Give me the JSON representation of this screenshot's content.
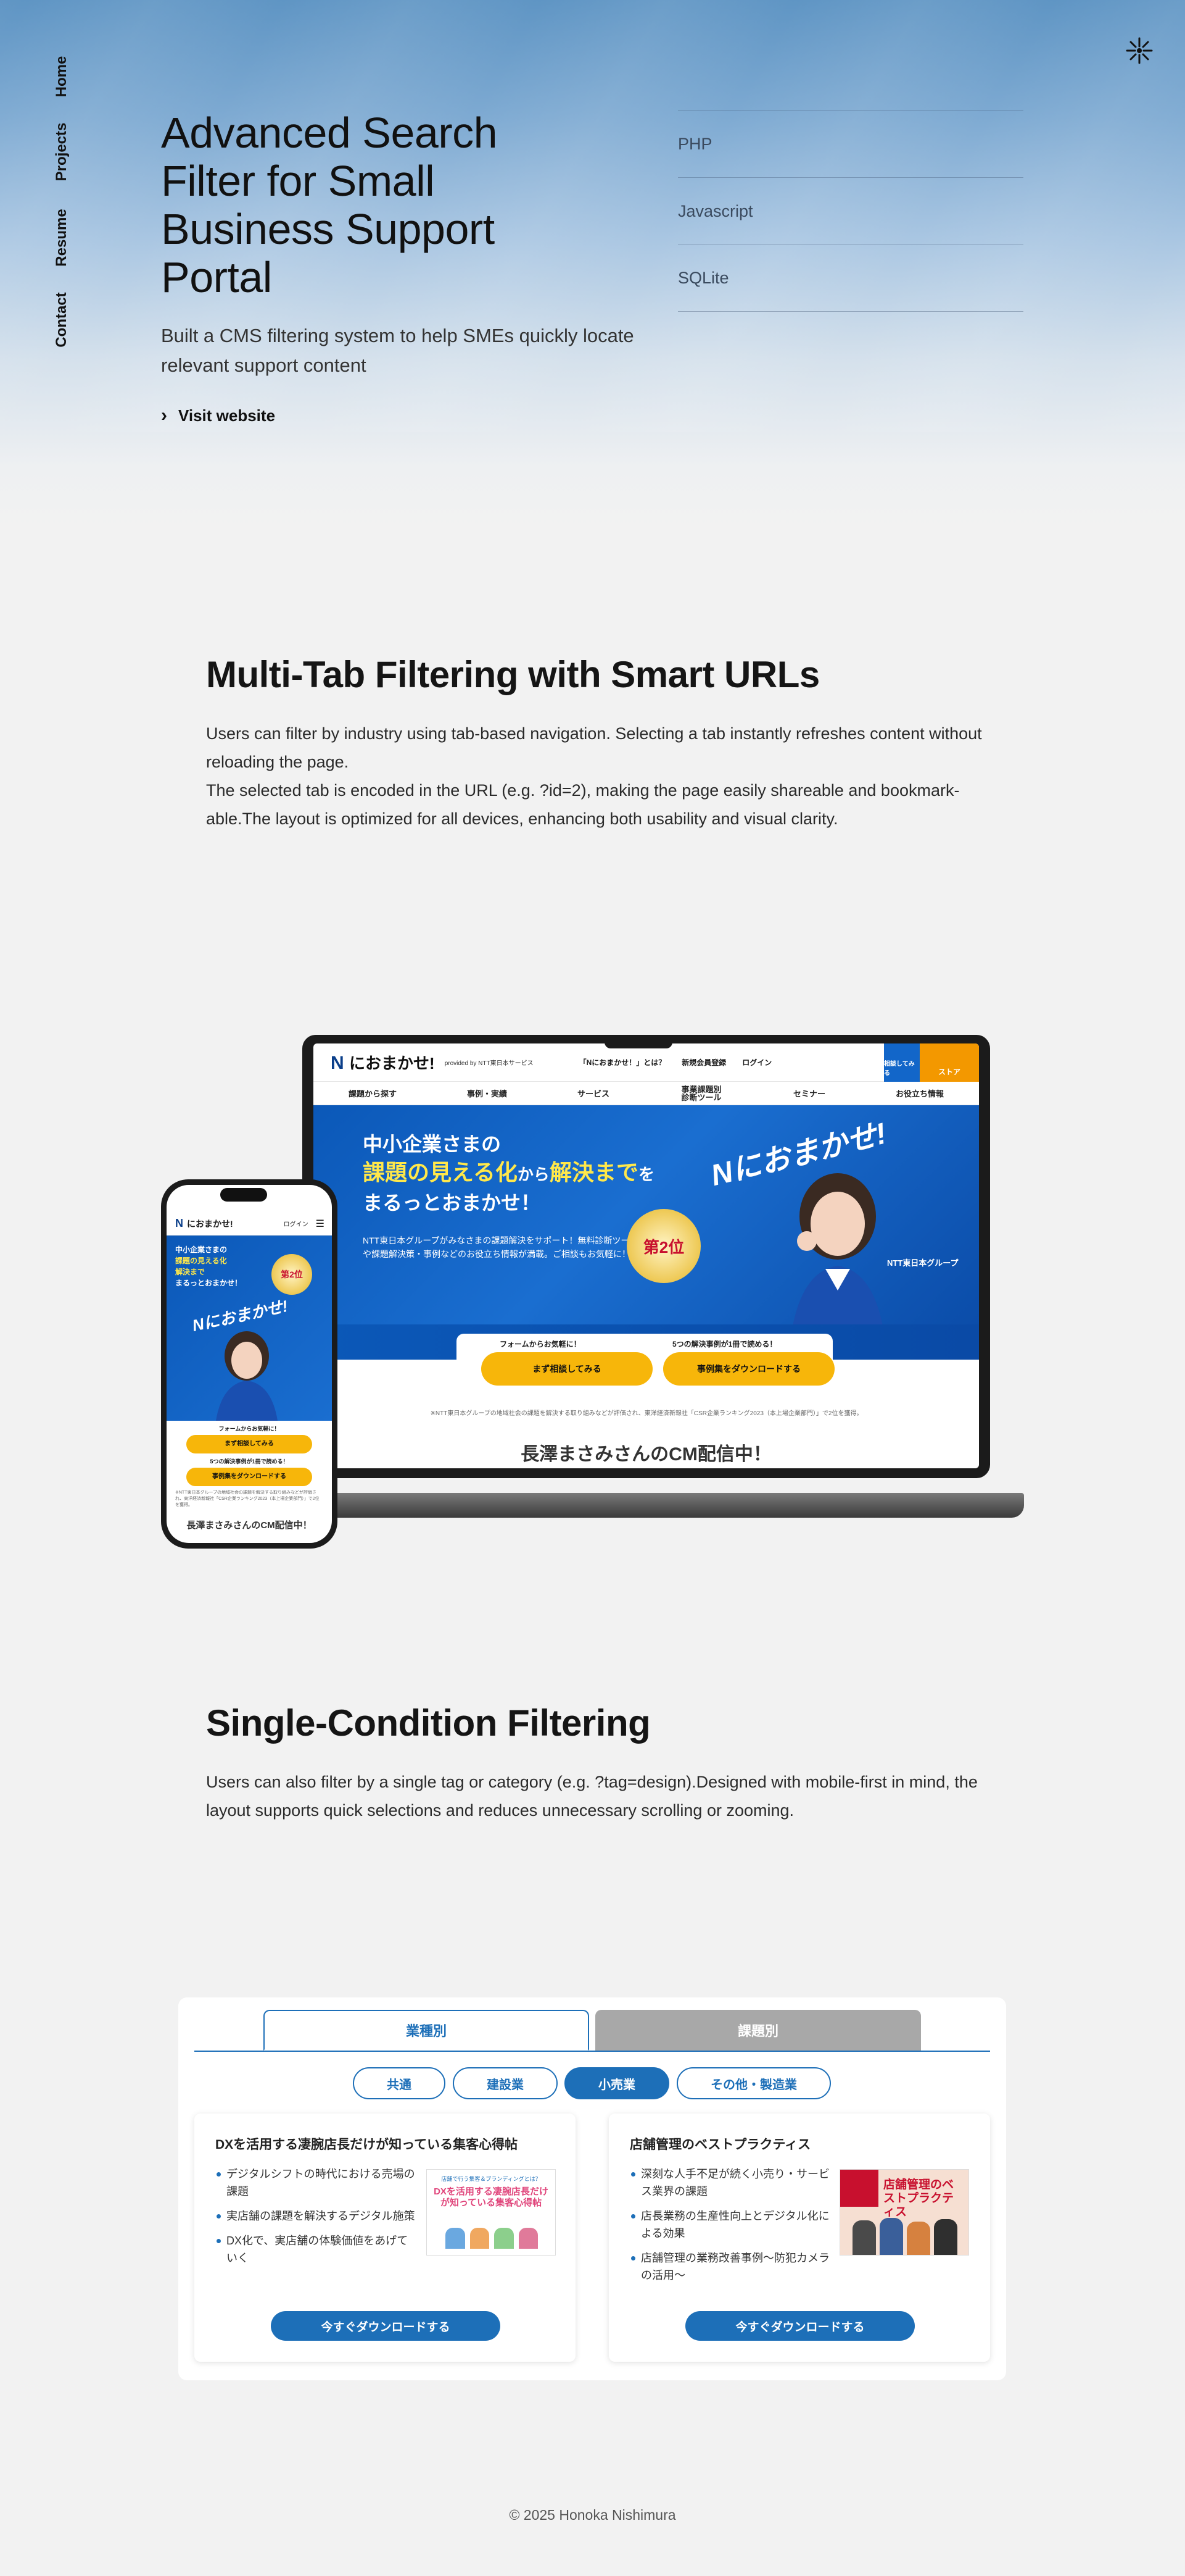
{
  "nav": {
    "home": "Home",
    "projects": "Projects",
    "resume": "Resume",
    "contact": "Contact"
  },
  "hero": {
    "title": "Advanced Search Filter for Small Business Support Portal",
    "subtitle": "Built a CMS filtering system to help SMEs quickly locate relevant support content",
    "visit_label": "Visit website",
    "tech": [
      "PHP",
      "Javascript",
      "SQLite"
    ]
  },
  "section1": {
    "title": "Multi-Tab Filtering with Smart URLs",
    "p1": "Users can filter by industry using tab-based navigation. Selecting a tab instantly refreshes content without reloading the page.",
    "p2": "The selected tab is encoded in the URL (e.g. ?id=2), making the page easily shareable and bookmark-able.The layout is optimized for all devices, enhancing both usability and visual clarity."
  },
  "mockup": {
    "logo_n": "N",
    "logo_text": "におまかせ!",
    "provided": "provided by NTT東日本サービス",
    "links": [
      "「Nにおまかせ！」とは？",
      "新規会員登録",
      "ログイン"
    ],
    "contact_btn": "相談してみる",
    "store_btn": "ストア",
    "menu": [
      "課題から探す",
      "事例・実績",
      "サービス",
      "事業課題別 診断ツール",
      "セミナー",
      "お役立ち情報"
    ],
    "hero_line1": "中小企業さまの",
    "hero_line2a": "課題の見える化",
    "hero_line2b": "から",
    "hero_line2c": "解決まで",
    "hero_line2d": "を",
    "hero_line3": "まるっとおまかせ！",
    "hero_desc": "NTT東日本グループがみなさまの課題解決をサポート！無料診断ツールや課題解決策・事例などのお役立ち情報が満載。ご相談もお気軽に！",
    "badge": "第2位",
    "brand_big": "Nにおまかせ!",
    "group": "NTT東日本グループ",
    "cta1_label": "フォームからお気軽に！",
    "cta1": "まず相談してみる",
    "cta2_label": "5つの解決事例が1冊で読める！",
    "cta2": "事例集をダウンロードする",
    "note": "※NTT東日本グループの地域社会の課題を解決する取り組みなどが評価され、東洋経済新報社「CSR企業ランキング2023（本上場企業部門）」で2位を獲得。",
    "cm": "長澤まさみさんのCM配信中！",
    "phone_login": "ログイン"
  },
  "section2": {
    "title": "Single-Condition Filtering",
    "p1": "Users can also filter by a single tag or category (e.g. ?tag=design).Designed with mobile-first in mind, the layout supports quick selections and reduces unnecessary scrolling or zooming."
  },
  "filter": {
    "tabs": [
      "業種別",
      "課題別"
    ],
    "pills": [
      "共通",
      "建設業",
      "小売業",
      "その他・製造業"
    ],
    "cards": [
      {
        "title": "DXを活用する凄腕店長だけが知っている集客心得帖",
        "items": [
          "デジタルシフトの時代における売場の課題",
          "実店舗の課題を解決するデジタル施策",
          "DX化で、実店舗の体験価値をあげていく"
        ],
        "thumb_top": "店舗で行う集客＆ブランディングとは？",
        "thumb_text": "DXを活用する凄腕店長だけが知っている集客心得帖",
        "button": "今すぐダウンロードする"
      },
      {
        "title": "店舗管理のベストプラクティス",
        "items": [
          "深刻な人手不足が続く小売り・サービス業界の課題",
          "店長業務の生産性向上とデジタル化による効果",
          "店舗管理の業務改善事例〜防犯カメラの活用〜"
        ],
        "thumb_text": "店舗管理のベストプラクティス",
        "button": "今すぐダウンロードする"
      }
    ]
  },
  "footer": {
    "copyright": "© 2025 Honoka Nishimura"
  },
  "colors": {
    "accent": "#1d6fb8",
    "ntt_blue": "#0b58b8",
    "cta_yellow": "#f7b60a",
    "store_orange": "#f39800"
  }
}
